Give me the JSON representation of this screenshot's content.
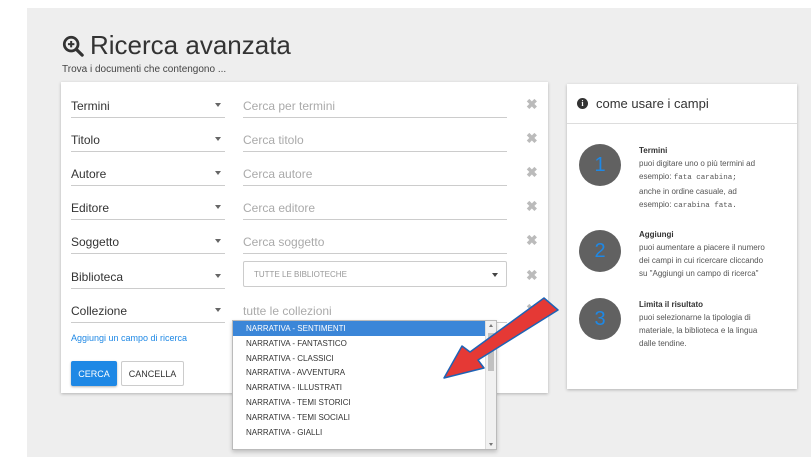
{
  "page": {
    "title": "Ricerca avanzata",
    "subtitle": "Trova i documenti che contengono ..."
  },
  "form": {
    "rows": [
      {
        "field": "Termini",
        "placeholder": "Cerca per termini"
      },
      {
        "field": "Titolo",
        "placeholder": "Cerca titolo"
      },
      {
        "field": "Autore",
        "placeholder": "Cerca autore"
      },
      {
        "field": "Editore",
        "placeholder": "Cerca editore"
      },
      {
        "field": "Soggetto",
        "placeholder": "Cerca soggetto"
      },
      {
        "field": "Biblioteca",
        "select_value": "TUTTE LE BIBLIOTECHE"
      },
      {
        "field": "Collezione",
        "placeholder": "tutte le collezioni"
      }
    ],
    "add_field_link": "Aggiungi un campo di ricerca",
    "search_button": "CERCA",
    "cancel_button": "CANCELLA"
  },
  "dropdown": {
    "options": [
      "NARRATIVA - SENTIMENTI",
      "NARRATIVA - FANTASTICO",
      "NARRATIVA - CLASSICI",
      "NARRATIVA - AVVENTURA",
      "NARRATIVA - ILLUSTRATI",
      "NARRATIVA - TEMI STORICI",
      "NARRATIVA - TEMI SOCIALI",
      "NARRATIVA - GIALLI"
    ],
    "selected_index": 0
  },
  "help": {
    "title": "come usare i campi",
    "steps": [
      {
        "number": "1",
        "heading": "Termini",
        "line1": "puoi digitare uno o più termini ad",
        "line2_prefix": "esempio: ",
        "line2_code": "fata carabina;",
        "line3": "anche in ordine casuale, ad",
        "line4_prefix": "esempio: ",
        "line4_code": "carabina fata."
      },
      {
        "number": "2",
        "heading": "Aggiungi",
        "line1": "puoi aumentare a piacere il numero",
        "line2": "dei campi in cui ricercare cliccando",
        "line3": "su \"Aggiungi un campo di ricerca\""
      },
      {
        "number": "3",
        "heading": "Limita il risultato",
        "line1": "puoi selezionarne la tipologia di",
        "line2": "materiale, la biblioteca e la lingua",
        "line3": "dalle tendine."
      }
    ]
  },
  "icons": {
    "title_icon": "zoom-in-icon",
    "clear_icon": "close-icon",
    "info_icon": "info-icon",
    "annotation": "red-arrow-annotation"
  },
  "colors": {
    "accent": "#1e88e5",
    "selected_option": "#3b86d8",
    "step_circle": "#616161",
    "arrow": "#e53935"
  }
}
